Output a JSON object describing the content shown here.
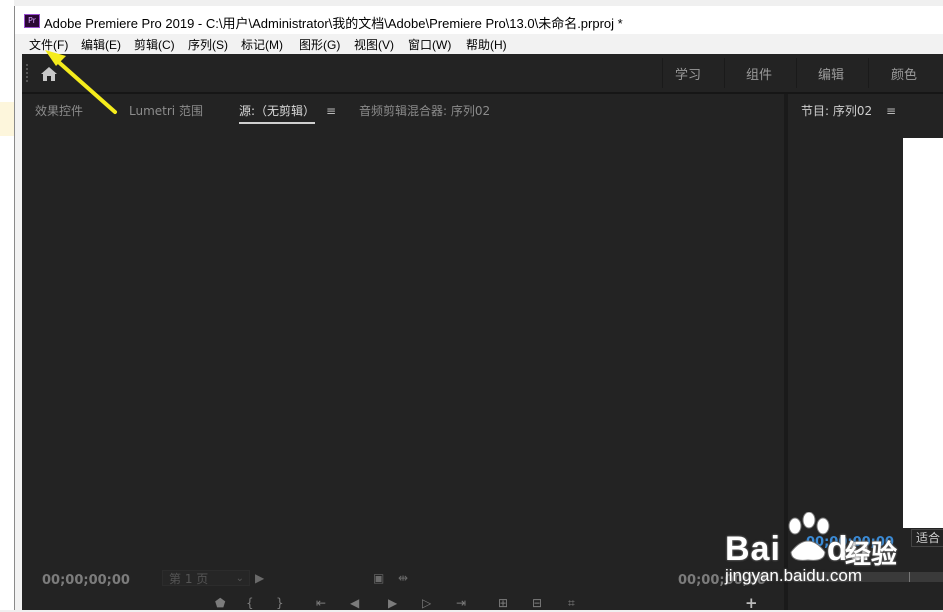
{
  "window": {
    "title": "Adobe Premiere Pro 2019 - C:\\用户\\Administrator\\我的文档\\Adobe\\Premiere Pro\\13.0\\未命名.prproj *",
    "app_icon": "Pr"
  },
  "menubar": {
    "items": [
      {
        "label": "文件(F)"
      },
      {
        "label": "编辑(E)"
      },
      {
        "label": "剪辑(C)"
      },
      {
        "label": "序列(S)"
      },
      {
        "label": "标记(M)"
      },
      {
        "label": "图形(G)"
      },
      {
        "label": "视图(V)"
      },
      {
        "label": "窗口(W)"
      },
      {
        "label": "帮助(H)"
      }
    ]
  },
  "header": {
    "home_icon": "home-icon",
    "workspaces": [
      {
        "label": "学习"
      },
      {
        "label": "组件"
      },
      {
        "label": "编辑"
      },
      {
        "label": "颜色"
      }
    ]
  },
  "source_panel": {
    "tabs": [
      {
        "label": "效果控件",
        "active": false
      },
      {
        "label": "Lumetri 范围",
        "active": false
      },
      {
        "label": "源:（无剪辑）",
        "active": true
      },
      {
        "label": "音频剪辑混合器: 序列02",
        "active": false
      }
    ],
    "menu_icon": "≡",
    "timecode_left": "00;00;00;00",
    "page_label": "第 1 页",
    "timecode_right": "00;00;00;00"
  },
  "program_panel": {
    "title": "节目: 序列02",
    "menu_icon": "≡",
    "fit_label": "适合",
    "timecode": "00;00;00;00"
  },
  "watermark": {
    "brand": "Bai",
    "brand_end": "du",
    "product": "经验",
    "url": "jingyan.baidu.com"
  },
  "colors": {
    "app_bg": "#1d1d1d",
    "panel_bg": "#232323",
    "timecode_blue": "#3b8bd6",
    "arrow": "#f5ec1c"
  }
}
